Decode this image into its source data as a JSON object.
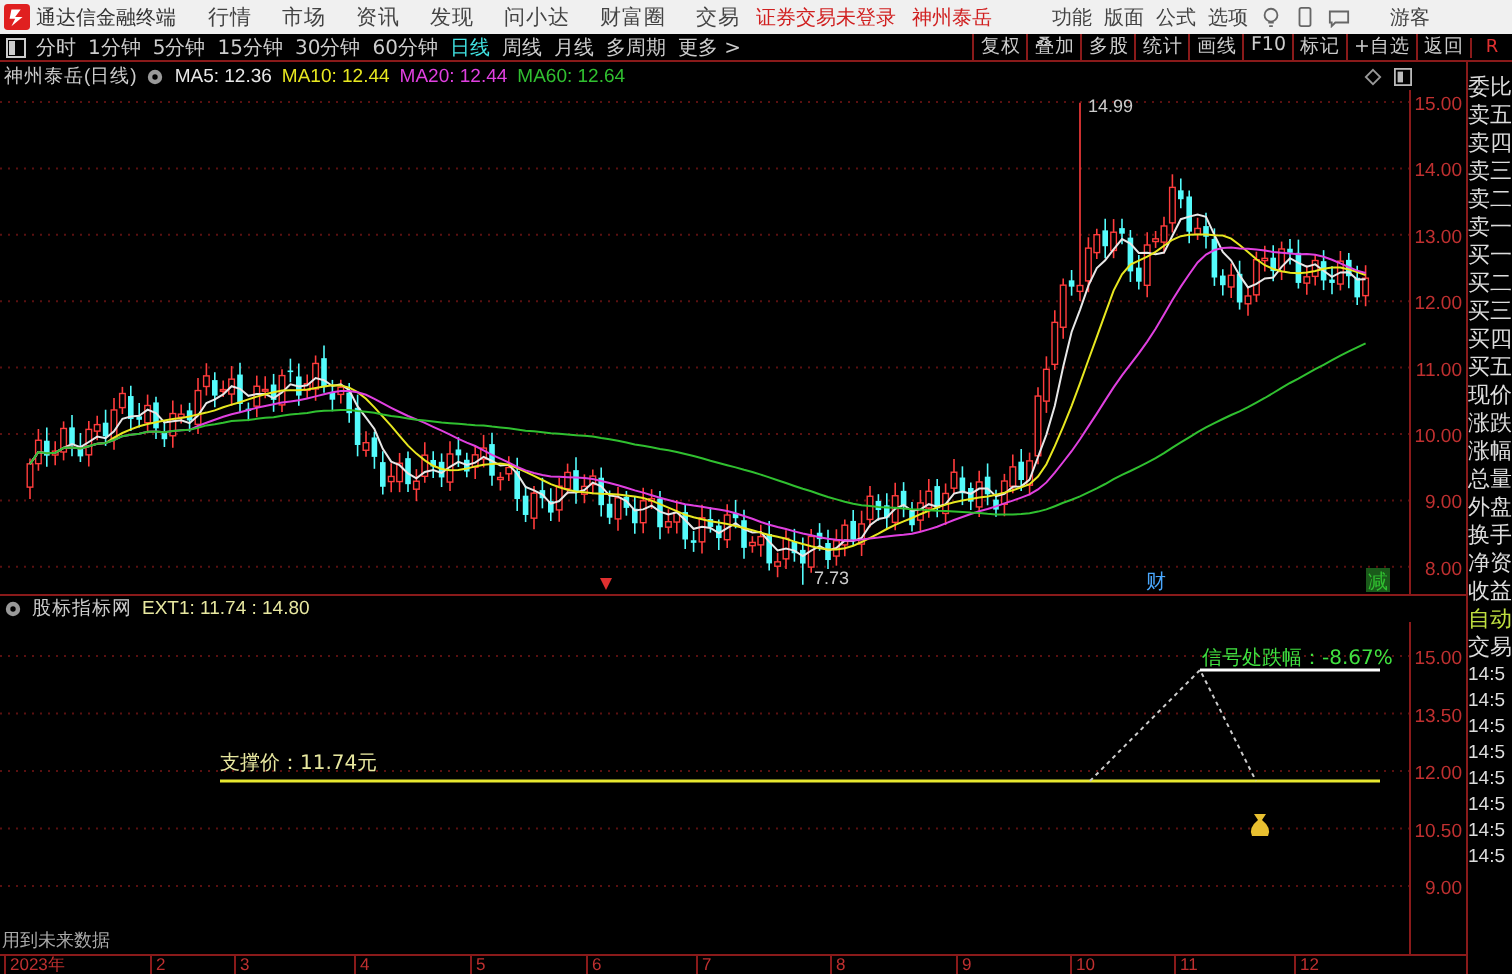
{
  "app": {
    "title": "通达信金融终端",
    "menu": [
      "行情",
      "市场",
      "资讯",
      "发现",
      "问小达",
      "财富圈",
      "交易"
    ],
    "login_status": "证券交易未登录",
    "stock_name": "神州泰岳",
    "right_menu": [
      "功能",
      "版面",
      "公式",
      "选项"
    ],
    "user": "游客"
  },
  "period_tabs": [
    {
      "label": "分时",
      "selected": false
    },
    {
      "label": "1分钟",
      "selected": false
    },
    {
      "label": "5分钟",
      "selected": false
    },
    {
      "label": "15分钟",
      "selected": false
    },
    {
      "label": "30分钟",
      "selected": false
    },
    {
      "label": "60分钟",
      "selected": false
    },
    {
      "label": "日线",
      "selected": true
    },
    {
      "label": "周线",
      "selected": false
    },
    {
      "label": "月线",
      "selected": false
    },
    {
      "label": "多周期",
      "selected": false
    },
    {
      "label": "更多 >",
      "selected": false
    }
  ],
  "tools": [
    "复权",
    "叠加",
    "多股",
    "统计",
    "画线",
    "F10",
    "标记",
    "+自选",
    "返回"
  ],
  "corner_mark": "R",
  "chart": {
    "title": "神州泰岳(日线)",
    "ma": [
      {
        "label": "MA5: 12.36",
        "color": "#e8e8e8"
      },
      {
        "label": "MA10: 12.44",
        "color": "#e8e820"
      },
      {
        "label": "MA20: 12.44",
        "color": "#e040e0"
      },
      {
        "label": "MA60: 12.64",
        "color": "#30c030"
      }
    ],
    "y_labels": [
      "15.00",
      "14.00",
      "13.00",
      "12.00",
      "11.00",
      "10.00",
      "9.00",
      "8.00"
    ],
    "high_label": "14.99",
    "low_label": "7.73",
    "markers": [
      {
        "kind": "finance",
        "label": "财"
      },
      {
        "kind": "reduce",
        "label": "减"
      }
    ]
  },
  "indicator": {
    "title": "股标指标网",
    "values": "EXT1: 11.74 : 14.80",
    "support_label": "支撑价：11.74元",
    "drop_label": "信号处跌幅：-8.67%",
    "y_labels": [
      "15.00",
      "13.50",
      "12.00",
      "10.50",
      "9.00"
    ],
    "note": "用到未来数据"
  },
  "date_axis": [
    "2023年",
    "2",
    "3",
    "4",
    "5",
    "6",
    "7",
    "8",
    "9",
    "10",
    "11",
    "12"
  ],
  "quote_panel": {
    "labels": [
      "委比",
      "卖五",
      "卖四",
      "卖三",
      "卖二",
      "卖一",
      "买一",
      "买二",
      "买三",
      "买四",
      "买五",
      "现价",
      "涨跌",
      "涨幅",
      "总量",
      "外盘",
      "换手",
      "净资",
      "收益"
    ],
    "mode_label": "自动",
    "trade_label": "交易",
    "times": [
      "14:5",
      "14:5",
      "14:5",
      "14:5",
      "14:5",
      "14:5",
      "14:5",
      "14:5"
    ]
  }
}
